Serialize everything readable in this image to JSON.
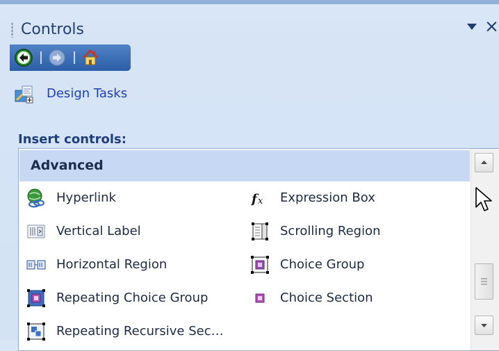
{
  "pane": {
    "title": "Controls",
    "dropdown_icon": "chevron-down-icon",
    "close_label": "×"
  },
  "nav": {
    "back_icon": "back-icon",
    "forward_icon": "forward-icon",
    "home_icon": "home-icon"
  },
  "tasks": {
    "icon": "design-tasks-icon",
    "label": "Design Tasks"
  },
  "insert": {
    "heading": "Insert controls:",
    "group": "Advanced",
    "items": [
      {
        "label": "Hyperlink",
        "icon": "hyperlink-icon"
      },
      {
        "label": "Expression Box",
        "icon": "expression-box-icon"
      },
      {
        "label": "Vertical Label",
        "icon": "vertical-label-icon"
      },
      {
        "label": "Scrolling Region",
        "icon": "scrolling-region-icon"
      },
      {
        "label": "Horizontal Region",
        "icon": "horizontal-region-icon"
      },
      {
        "label": "Choice Group",
        "icon": "choice-group-icon"
      },
      {
        "label": "Repeating Choice Group",
        "icon": "repeating-choice-group-icon"
      },
      {
        "label": "Choice Section",
        "icon": "choice-section-icon"
      },
      {
        "label": "Repeating Recursive Sec…",
        "icon": "repeating-recursive-section-icon"
      }
    ]
  },
  "colors": {
    "link": "#1f3fbf",
    "heading": "#1f3f7a",
    "group_bg": "#c6d8f3",
    "nav_bg": "#2d5ea8"
  }
}
